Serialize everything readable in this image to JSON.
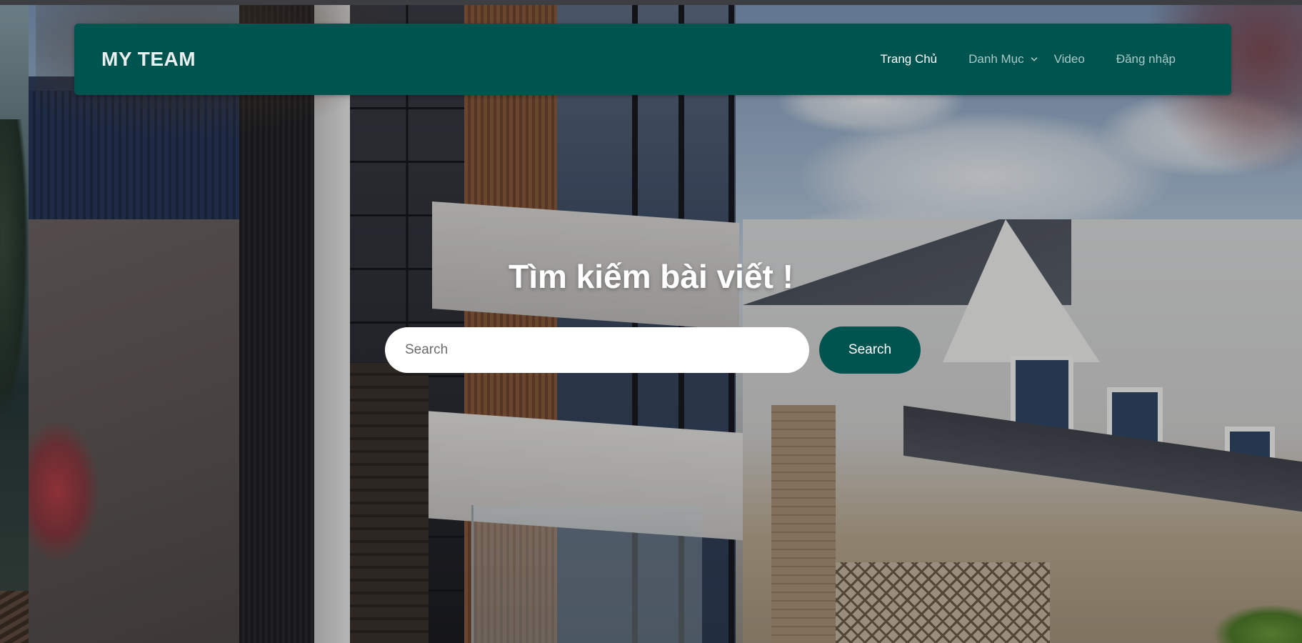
{
  "navbar": {
    "brand": "MY TEAM",
    "items": [
      {
        "label": "Trang Chủ",
        "active": true
      },
      {
        "label": "Danh Mục",
        "dropdown": true
      },
      {
        "label": "Video"
      },
      {
        "label": "Đăng nhập"
      }
    ],
    "icons": {
      "dropdown": "chevron-down-icon"
    }
  },
  "hero": {
    "title": "Tìm kiếm bài viết !",
    "search": {
      "placeholder": "Search",
      "value": "",
      "button_label": "Search"
    }
  },
  "colors": {
    "primary": "#005450",
    "nav_text": "#a9c9c6",
    "nav_active": "#ffffff"
  }
}
